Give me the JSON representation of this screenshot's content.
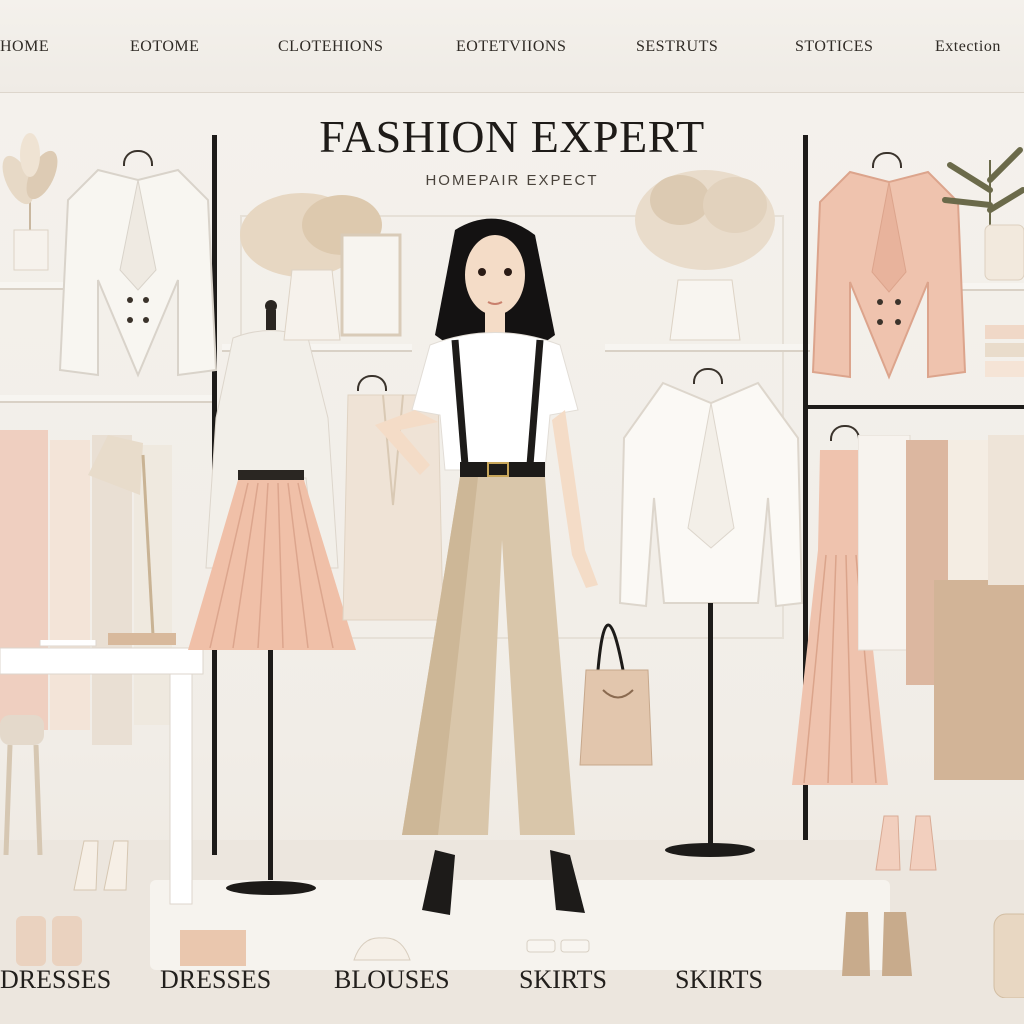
{
  "nav": {
    "items": [
      "HOME",
      "EOTOME",
      "CLOTEHIONS",
      "EOTETVIIONS",
      "SESTRUTS",
      "STOTICES",
      "Extection"
    ]
  },
  "brand": {
    "title": "FASHION EXPERT",
    "tagline": "HOMEPAIR EXPECT"
  },
  "categories": [
    "DRESSES",
    "DRESSES",
    "BLOUSES",
    "SKIRTS",
    "SKIRTS"
  ],
  "colors": {
    "background": "#f1ede7",
    "blush": "#e8b9a5",
    "beige": "#d8c5ac",
    "ivory": "#f8f6f1",
    "black": "#1d1b19"
  }
}
